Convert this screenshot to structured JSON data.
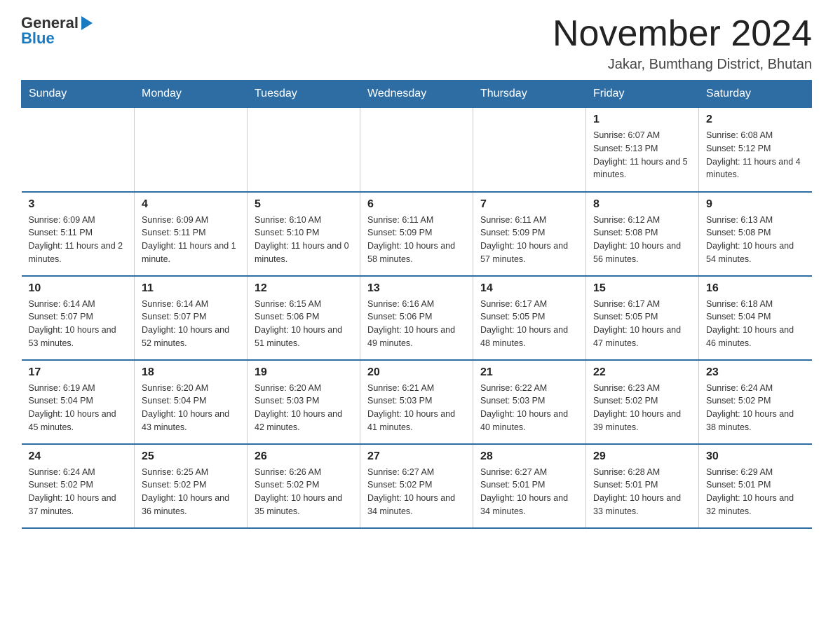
{
  "header": {
    "logo_general": "General",
    "logo_blue": "Blue",
    "month_title": "November 2024",
    "location": "Jakar, Bumthang District, Bhutan"
  },
  "days_of_week": [
    "Sunday",
    "Monday",
    "Tuesday",
    "Wednesday",
    "Thursday",
    "Friday",
    "Saturday"
  ],
  "weeks": [
    [
      {
        "day": "",
        "info": ""
      },
      {
        "day": "",
        "info": ""
      },
      {
        "day": "",
        "info": ""
      },
      {
        "day": "",
        "info": ""
      },
      {
        "day": "",
        "info": ""
      },
      {
        "day": "1",
        "info": "Sunrise: 6:07 AM\nSunset: 5:13 PM\nDaylight: 11 hours and 5 minutes."
      },
      {
        "day": "2",
        "info": "Sunrise: 6:08 AM\nSunset: 5:12 PM\nDaylight: 11 hours and 4 minutes."
      }
    ],
    [
      {
        "day": "3",
        "info": "Sunrise: 6:09 AM\nSunset: 5:11 PM\nDaylight: 11 hours and 2 minutes."
      },
      {
        "day": "4",
        "info": "Sunrise: 6:09 AM\nSunset: 5:11 PM\nDaylight: 11 hours and 1 minute."
      },
      {
        "day": "5",
        "info": "Sunrise: 6:10 AM\nSunset: 5:10 PM\nDaylight: 11 hours and 0 minutes."
      },
      {
        "day": "6",
        "info": "Sunrise: 6:11 AM\nSunset: 5:09 PM\nDaylight: 10 hours and 58 minutes."
      },
      {
        "day": "7",
        "info": "Sunrise: 6:11 AM\nSunset: 5:09 PM\nDaylight: 10 hours and 57 minutes."
      },
      {
        "day": "8",
        "info": "Sunrise: 6:12 AM\nSunset: 5:08 PM\nDaylight: 10 hours and 56 minutes."
      },
      {
        "day": "9",
        "info": "Sunrise: 6:13 AM\nSunset: 5:08 PM\nDaylight: 10 hours and 54 minutes."
      }
    ],
    [
      {
        "day": "10",
        "info": "Sunrise: 6:14 AM\nSunset: 5:07 PM\nDaylight: 10 hours and 53 minutes."
      },
      {
        "day": "11",
        "info": "Sunrise: 6:14 AM\nSunset: 5:07 PM\nDaylight: 10 hours and 52 minutes."
      },
      {
        "day": "12",
        "info": "Sunrise: 6:15 AM\nSunset: 5:06 PM\nDaylight: 10 hours and 51 minutes."
      },
      {
        "day": "13",
        "info": "Sunrise: 6:16 AM\nSunset: 5:06 PM\nDaylight: 10 hours and 49 minutes."
      },
      {
        "day": "14",
        "info": "Sunrise: 6:17 AM\nSunset: 5:05 PM\nDaylight: 10 hours and 48 minutes."
      },
      {
        "day": "15",
        "info": "Sunrise: 6:17 AM\nSunset: 5:05 PM\nDaylight: 10 hours and 47 minutes."
      },
      {
        "day": "16",
        "info": "Sunrise: 6:18 AM\nSunset: 5:04 PM\nDaylight: 10 hours and 46 minutes."
      }
    ],
    [
      {
        "day": "17",
        "info": "Sunrise: 6:19 AM\nSunset: 5:04 PM\nDaylight: 10 hours and 45 minutes."
      },
      {
        "day": "18",
        "info": "Sunrise: 6:20 AM\nSunset: 5:04 PM\nDaylight: 10 hours and 43 minutes."
      },
      {
        "day": "19",
        "info": "Sunrise: 6:20 AM\nSunset: 5:03 PM\nDaylight: 10 hours and 42 minutes."
      },
      {
        "day": "20",
        "info": "Sunrise: 6:21 AM\nSunset: 5:03 PM\nDaylight: 10 hours and 41 minutes."
      },
      {
        "day": "21",
        "info": "Sunrise: 6:22 AM\nSunset: 5:03 PM\nDaylight: 10 hours and 40 minutes."
      },
      {
        "day": "22",
        "info": "Sunrise: 6:23 AM\nSunset: 5:02 PM\nDaylight: 10 hours and 39 minutes."
      },
      {
        "day": "23",
        "info": "Sunrise: 6:24 AM\nSunset: 5:02 PM\nDaylight: 10 hours and 38 minutes."
      }
    ],
    [
      {
        "day": "24",
        "info": "Sunrise: 6:24 AM\nSunset: 5:02 PM\nDaylight: 10 hours and 37 minutes."
      },
      {
        "day": "25",
        "info": "Sunrise: 6:25 AM\nSunset: 5:02 PM\nDaylight: 10 hours and 36 minutes."
      },
      {
        "day": "26",
        "info": "Sunrise: 6:26 AM\nSunset: 5:02 PM\nDaylight: 10 hours and 35 minutes."
      },
      {
        "day": "27",
        "info": "Sunrise: 6:27 AM\nSunset: 5:02 PM\nDaylight: 10 hours and 34 minutes."
      },
      {
        "day": "28",
        "info": "Sunrise: 6:27 AM\nSunset: 5:01 PM\nDaylight: 10 hours and 34 minutes."
      },
      {
        "day": "29",
        "info": "Sunrise: 6:28 AM\nSunset: 5:01 PM\nDaylight: 10 hours and 33 minutes."
      },
      {
        "day": "30",
        "info": "Sunrise: 6:29 AM\nSunset: 5:01 PM\nDaylight: 10 hours and 32 minutes."
      }
    ]
  ]
}
